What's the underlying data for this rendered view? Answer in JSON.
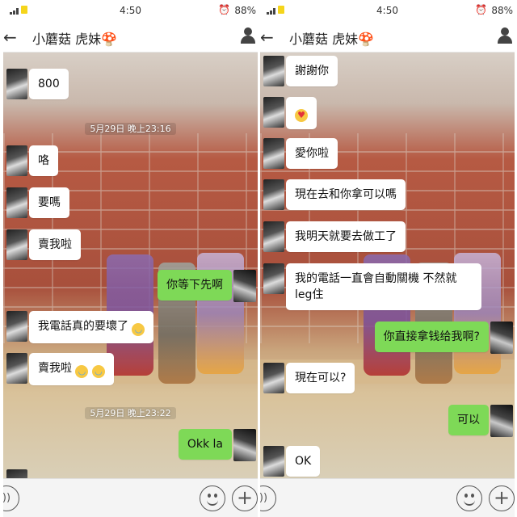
{
  "statusbar": {
    "time": "4:50",
    "battery": "88%"
  },
  "header": {
    "title_left": "小蘑菇",
    "title_mid": "",
    "title_right": "虎妹🍄"
  },
  "left": {
    "messages": [
      {
        "text": "800"
      },
      {
        "text": "咯"
      },
      {
        "text": "要嗎"
      },
      {
        "text": "賣我啦"
      },
      {
        "text": "你等下先啊"
      },
      {
        "text": "我電話真的要壞了"
      },
      {
        "text": "賣我啦"
      },
      {
        "text": "Okk la"
      }
    ],
    "timestamps": [
      "5月29日 晚上23:16",
      "5月29日 晚上23:22"
    ]
  },
  "right": {
    "messages": [
      {
        "text": "謝謝你"
      },
      {
        "text": ""
      },
      {
        "text": "愛你啦"
      },
      {
        "text": "現在去和你拿可以嗎"
      },
      {
        "text": "我明天就要去做工了"
      },
      {
        "text": "我的電話一直會自動關機 不然就leg住"
      },
      {
        "text": "你直接拿钱给我啊?"
      },
      {
        "text": "現在可以?"
      },
      {
        "text": "可以"
      },
      {
        "text": "OK"
      }
    ]
  },
  "icons": {
    "cry": "😭",
    "love": "😍"
  },
  "colors": {
    "outgoing_bubble": "#7ed957",
    "incoming_bubble": "#ffffff"
  }
}
